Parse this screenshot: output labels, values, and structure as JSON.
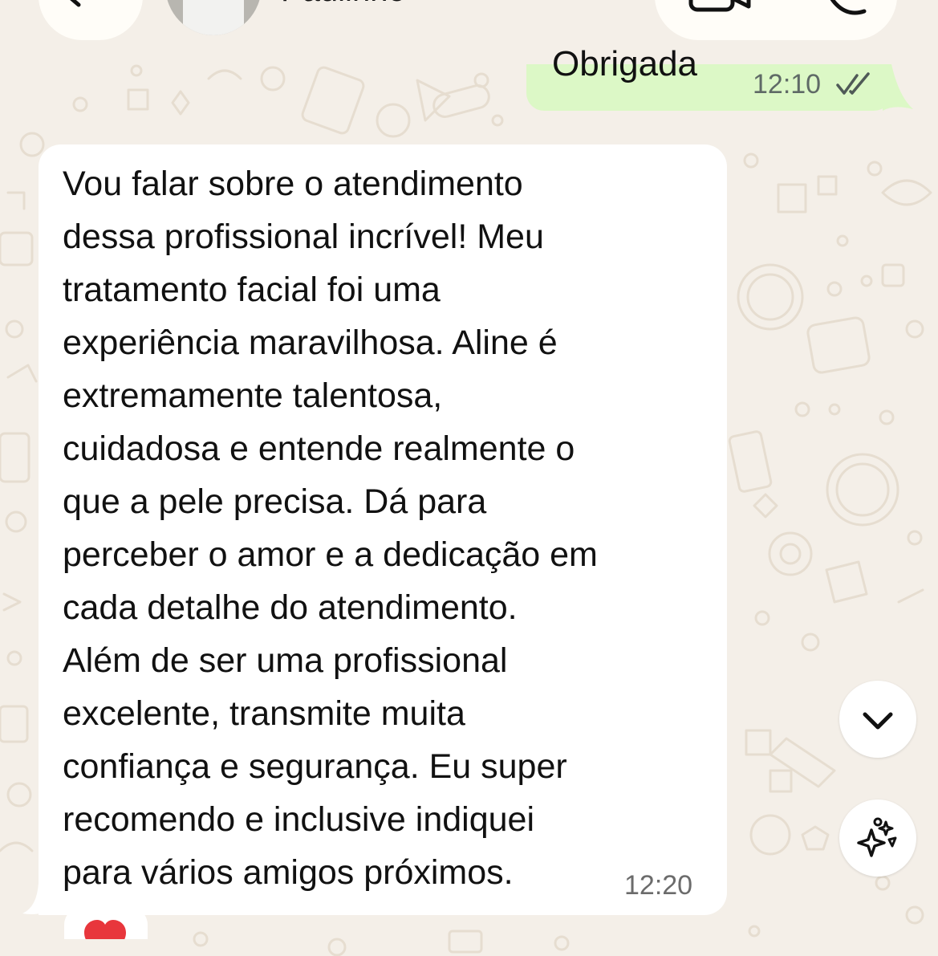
{
  "header": {
    "contact_name": "Paulinho",
    "back_icon": "back-arrow-icon",
    "video_icon": "video-camera-icon",
    "call_icon": "phone-icon"
  },
  "messages": {
    "outgoing": {
      "text": "Obrigada",
      "time": "12:10",
      "status_icon": "double-check-icon"
    },
    "incoming": {
      "lines": [
        "Vou falar sobre o atendimento",
        "dessa profissional incrível!  Meu",
        "tratamento facial foi uma",
        "experiência maravilhosa. Aline é",
        "extremamente talentosa,",
        "cuidadosa e entende realmente o",
        "que a pele precisa. Dá para",
        "perceber o amor e a dedicação em",
        "cada detalhe do atendimento.",
        "Além de ser uma profissional",
        "excelente, transmite muita",
        "confiança e segurança. Eu super",
        "recomendo e inclusive indiquei",
        "para vários amigos próximos."
      ],
      "time": "12:20",
      "reaction": "❤️"
    }
  },
  "controls": {
    "scroll_down_icon": "chevron-down-icon",
    "ai_icon": "sparkles-icon"
  },
  "colors": {
    "wallpaper": "#f4efe8",
    "outgoing_bubble": "#dcf8c6",
    "incoming_bubble": "#ffffff",
    "heart": "#e8363c"
  }
}
